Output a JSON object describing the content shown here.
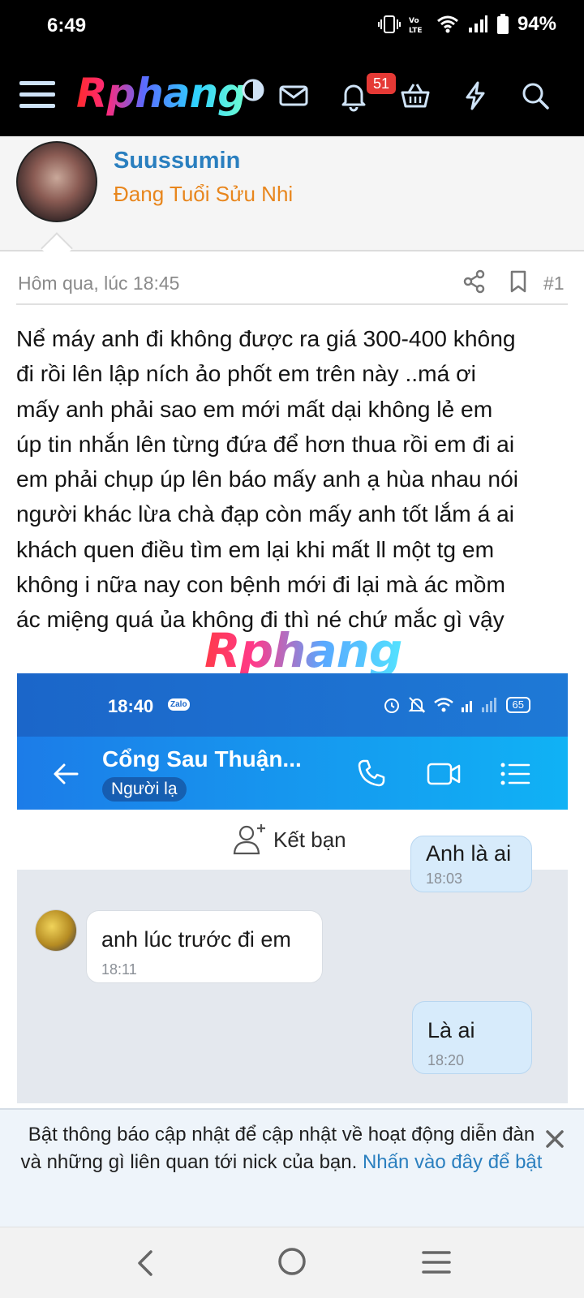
{
  "status_bar": {
    "time": "6:49",
    "battery": "94%",
    "icons": [
      "vibrate-icon",
      "volte-icon",
      "wifi-icon",
      "signal-icon",
      "battery-icon"
    ]
  },
  "app_header": {
    "logo": "Rphang",
    "notification_count": "51",
    "icons": [
      "menu-icon",
      "theme-toggle-icon",
      "mail-icon",
      "bell-icon",
      "basket-icon",
      "lightning-icon",
      "search-icon"
    ]
  },
  "poster": {
    "name": "Suussumin",
    "title": "Đang Tuổi Sửu Nhi"
  },
  "post": {
    "date": "Hôm qua, lúc 18:45",
    "number": "#1",
    "body": "Nể máy anh đi không được ra giá 300-400 không\nđi rồi lên lập ních ảo phốt em trên này ..má ơi\nmấy anh phải sao em mới mất dại không lẻ em\núp tin nhắn lên từng đứa để hơn thua rồi em đi ai\nem phải chụp úp lên báo mấy anh ạ hùa nhau nói\nngười khác lừa chà đạp còn mấy anh tốt lắm á ai\nkhách quen điều tìm em lại khi mất ll một tg em\nkhông i nữa nay con bệnh mới đi lại mà ác mồm\nác miệng quá ủa không đi thì né chứ mắc gì vậy",
    "watermark": "Rphang"
  },
  "embedded_screenshot": {
    "status_time": "18:40",
    "app_chip": "Zalo",
    "battery": "65",
    "contact_name": "Cổng Sau Thuận...",
    "contact_tag": "Người lạ",
    "add_friend_label": "Kết bạn",
    "messages": [
      {
        "direction": "out",
        "text": "Anh là ai",
        "time": "18:03"
      },
      {
        "direction": "in",
        "text": "anh lúc trước đi em",
        "time": "18:11"
      },
      {
        "direction": "out",
        "text": "Là ai",
        "time": "18:20"
      }
    ]
  },
  "notice": {
    "text": "Bật thông báo cập nhật để cập nhật về hoạt động diễn đàn và những gì liên quan tới nick của bạn. ",
    "link": "Nhấn vào đây để bật"
  },
  "colors": {
    "header_bg": "#000000",
    "poster_name": "#2a7fbf",
    "poster_title": "#e8861d",
    "badge": "#e53935",
    "link": "#2a7fbf"
  }
}
